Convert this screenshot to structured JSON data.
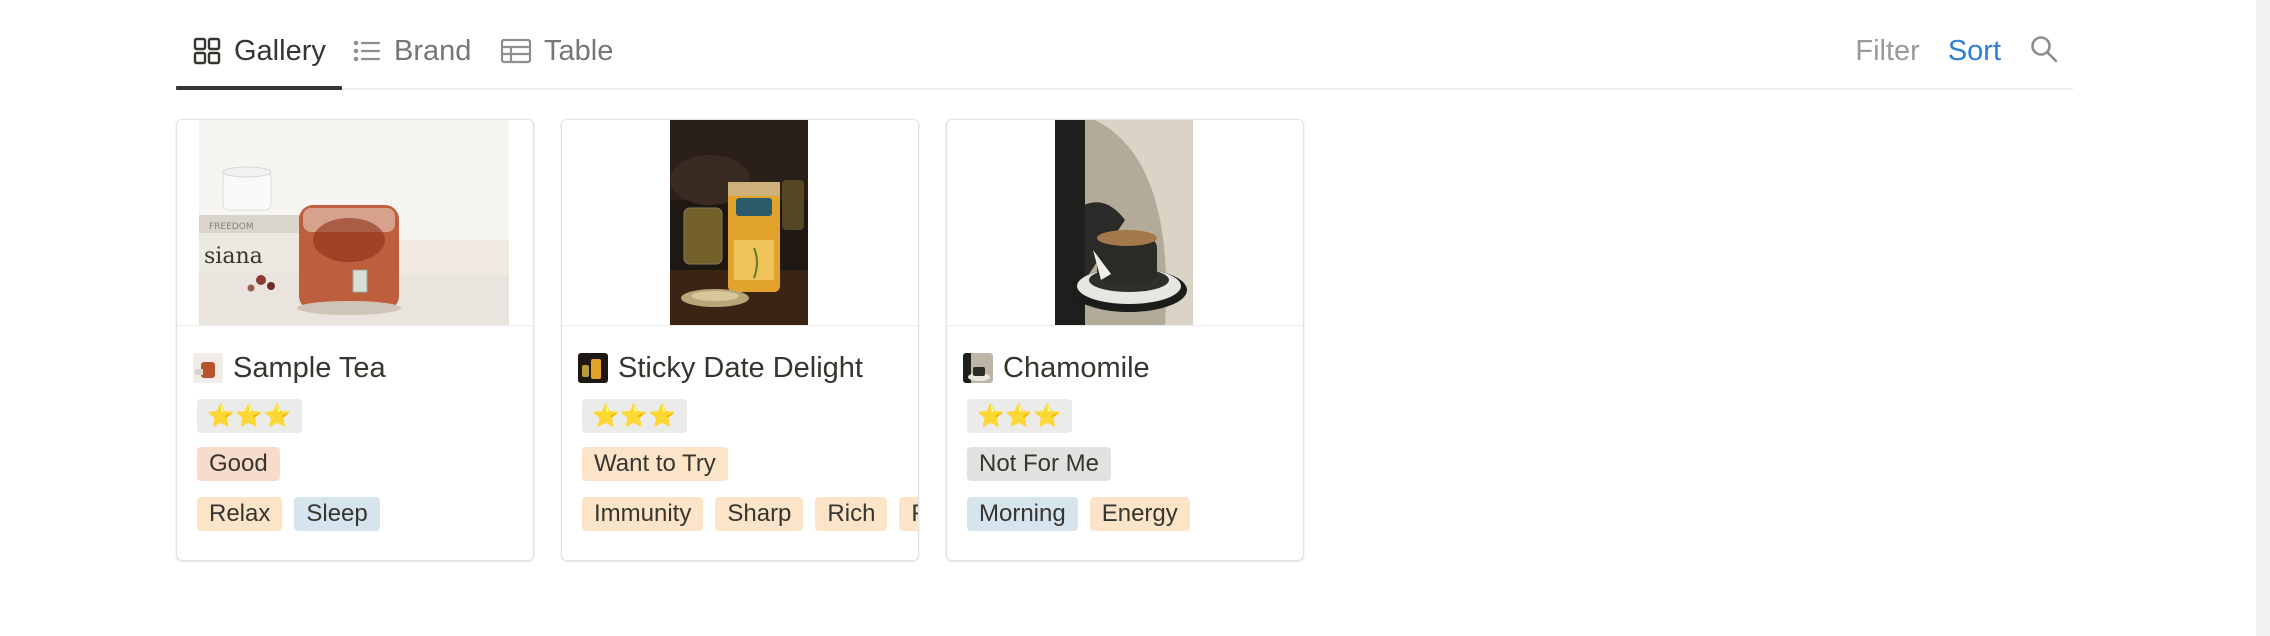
{
  "tabs": [
    {
      "label": "Gallery",
      "icon": "gallery-grid-icon",
      "active": true
    },
    {
      "label": "Brand",
      "icon": "list-icon",
      "active": false
    },
    {
      "label": "Table",
      "icon": "table-icon",
      "active": false
    }
  ],
  "toolbar": {
    "filter_label": "Filter",
    "sort_label": "Sort",
    "search_icon": "search-icon",
    "sort_color": "#2f7fd6"
  },
  "cards": [
    {
      "title": "Sample Tea",
      "rating": "⭐⭐⭐",
      "status": {
        "label": "Good",
        "color": "#f7dccb"
      },
      "tags": [
        {
          "label": "Relax",
          "color": "#fbe4c8"
        },
        {
          "label": "Sleep",
          "color": "#d6e4ee"
        }
      ]
    },
    {
      "title": "Sticky Date Delight",
      "rating": "⭐⭐⭐",
      "status": {
        "label": "Want to Try",
        "color": "#fbe4c8"
      },
      "tags": [
        {
          "label": "Immunity",
          "color": "#fbe4c8"
        },
        {
          "label": "Sharp",
          "color": "#fbe4c8"
        },
        {
          "label": "Rich",
          "color": "#fbe4c8"
        },
        {
          "label": "F",
          "color": "#fbe4c8"
        }
      ]
    },
    {
      "title": "Chamomile",
      "rating": "⭐⭐⭐",
      "status": {
        "label": "Not For Me",
        "color": "#e3e2e0"
      },
      "tags": [
        {
          "label": "Morning",
          "color": "#d6e4ee"
        },
        {
          "label": "Energy",
          "color": "#fbe4c8"
        }
      ]
    }
  ]
}
